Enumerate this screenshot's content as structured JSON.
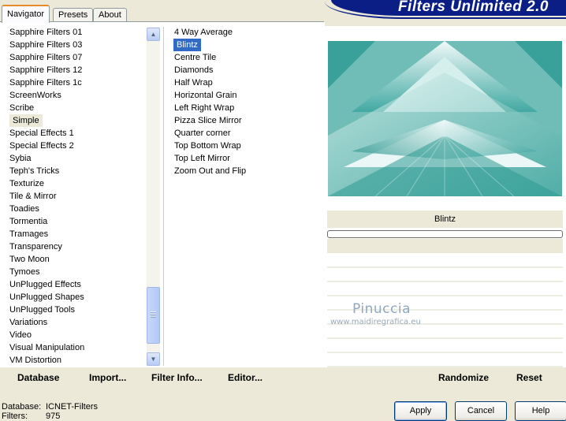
{
  "app": {
    "title": "Filters Unlimited 2.0"
  },
  "tabs": [
    {
      "label": "Navigator",
      "active": true
    },
    {
      "label": "Presets",
      "active": false
    },
    {
      "label": "About",
      "active": false
    }
  ],
  "categories": {
    "items": [
      "Sapphire Filters 01",
      "Sapphire Filters 03",
      "Sapphire Filters 07",
      "Sapphire Filters 12",
      "Sapphire Filters 1c",
      "ScreenWorks",
      "Scribe",
      "Simple",
      "Special Effects 1",
      "Special Effects 2",
      "Sybia",
      "Teph's Tricks",
      "Texturize",
      "Tile & Mirror",
      "Toadies",
      "Tormentia",
      "Tramages",
      "Transparency",
      "Two Moon",
      "Tymoes",
      "UnPlugged Effects",
      "UnPlugged Shapes",
      "UnPlugged Tools",
      "Variations",
      "Video",
      "Visual Manipulation",
      "VM Distortion"
    ],
    "selected": "Simple"
  },
  "filters": {
    "items": [
      "4 Way Average",
      "Blintz",
      "Centre Tile",
      "Diamonds",
      "Half Wrap",
      "Horizontal Grain",
      "Left Right Wrap",
      "Pizza Slice Mirror",
      "Quarter corner",
      "Top Bottom Wrap",
      "Top Left Mirror",
      "Zoom Out and Flip"
    ],
    "selected": "Blintz"
  },
  "toolbar": {
    "database": "Database",
    "import": "Import...",
    "filter_info": "Filter Info...",
    "editor": "Editor..."
  },
  "preview": {
    "filter_name": "Blintz",
    "progress": 0,
    "watermark": "Pinuccia",
    "watermark_url": "www.maidiregrafica.eu"
  },
  "right_toolbar": {
    "randomize": "Randomize",
    "reset": "Reset"
  },
  "footer": {
    "database_label": "Database:",
    "database_value": "ICNET-Filters",
    "filters_label": "Filters:",
    "filters_value": "975",
    "apply": "Apply",
    "cancel": "Cancel",
    "help": "Help"
  },
  "colors": {
    "banner": "#0b1e86",
    "selection": "#316ac5",
    "preview_teal": "#2e9a94",
    "dialog_bg": "#ece9d8"
  }
}
